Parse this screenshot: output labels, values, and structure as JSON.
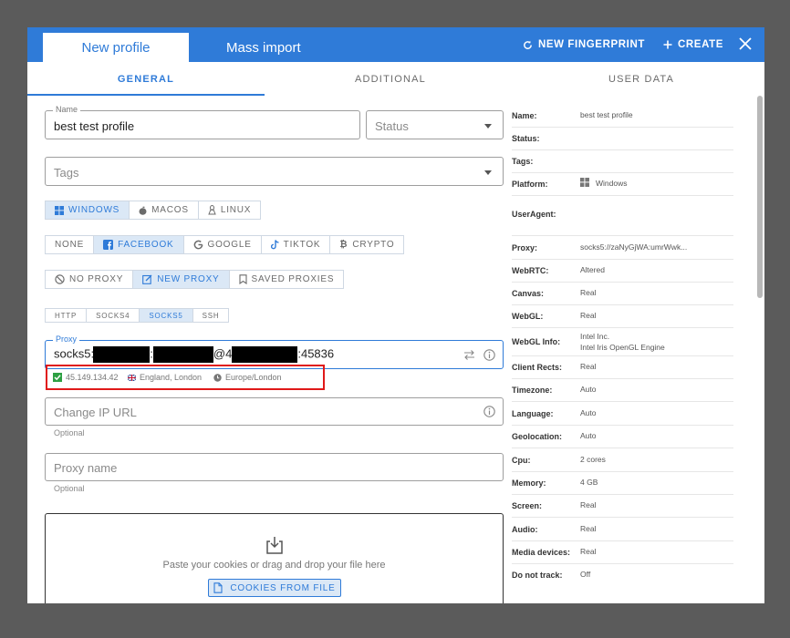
{
  "header": {
    "tab_new_profile": "New profile",
    "tab_mass_import": "Mass import",
    "new_fingerprint": "NEW FINGERPRINT",
    "create": "CREATE"
  },
  "subtabs": [
    "GENERAL",
    "ADDITIONAL",
    "USER DATA"
  ],
  "form": {
    "name_label": "Name",
    "name_value": "best test profile",
    "status_placeholder": "Status",
    "tags_placeholder": "Tags",
    "os_options": [
      "WINDOWS",
      "MACOS",
      "LINUX"
    ],
    "os_selected": "WINDOWS",
    "templates": [
      "NONE",
      "FACEBOOK",
      "GOOGLE",
      "TIKTOK",
      "CRYPTO"
    ],
    "template_selected": "FACEBOOK",
    "proxy_modes": [
      "NO PROXY",
      "NEW PROXY",
      "SAVED PROXIES"
    ],
    "proxy_mode_selected": "NEW PROXY",
    "proxy_types": [
      "HTTP",
      "SOCKS4",
      "SOCKS5",
      "SSH"
    ],
    "proxy_type_selected": "SOCKS5",
    "proxy_label": "Proxy",
    "proxy_prefix": "socks5://",
    "proxy_at": "@4",
    "proxy_port": ":45836",
    "check_ip": "45.149.134.42",
    "check_location": "England, London",
    "check_timezone": "Europe/London",
    "change_ip_placeholder": "Change IP URL",
    "optional": "Optional",
    "proxy_name_placeholder": "Proxy name",
    "cookies_text": "Paste your cookies or drag and drop your file here",
    "cookies_button": "COOKIES FROM FILE"
  },
  "summary": [
    {
      "key": "Name:",
      "value": "best test profile"
    },
    {
      "key": "Status:",
      "value": ""
    },
    {
      "key": "Tags:",
      "value": ""
    },
    {
      "key": "Platform:",
      "value": "Windows"
    },
    {
      "key": "UserAgent:",
      "value": ""
    },
    {
      "key": "Proxy:",
      "value": "socks5://zaNyGjWA:umrWwk..."
    },
    {
      "key": "WebRTC:",
      "value": "Altered"
    },
    {
      "key": "Canvas:",
      "value": "Real"
    },
    {
      "key": "WebGL:",
      "value": "Real"
    },
    {
      "key": "WebGL Info:",
      "value": "Intel Inc.",
      "value2": "Intel Iris OpenGL Engine"
    },
    {
      "key": "Client Rects:",
      "value": "Real"
    },
    {
      "key": "Timezone:",
      "value": "Auto"
    },
    {
      "key": "Language:",
      "value": "Auto"
    },
    {
      "key": "Geolocation:",
      "value": "Auto"
    },
    {
      "key": "Cpu:",
      "value": "2 cores"
    },
    {
      "key": "Memory:",
      "value": "4 GB"
    },
    {
      "key": "Screen:",
      "value": "Real"
    },
    {
      "key": "Audio:",
      "value": "Real"
    },
    {
      "key": "Media devices:",
      "value": "Real"
    },
    {
      "key": "Do not track:",
      "value": "Off"
    }
  ],
  "colors": {
    "accent": "#2f7bd8",
    "highlight_box": "#e01919",
    "ok": "#2ea043"
  }
}
